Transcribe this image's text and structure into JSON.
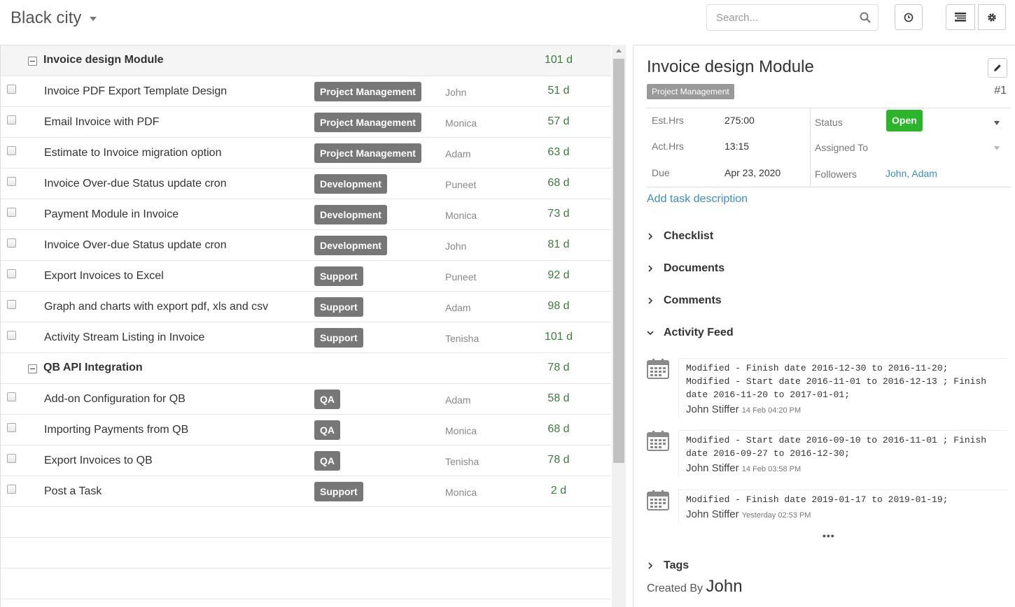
{
  "header": {
    "project": "Black city",
    "search_placeholder": "Search..."
  },
  "task_list": {
    "rows": [
      {
        "kind": "group",
        "name": "Invoice design Module",
        "days": "101 d"
      },
      {
        "kind": "task",
        "name": "Invoice PDF Export Template Design",
        "label": "Project Management",
        "assignee": "John",
        "days": "51 d"
      },
      {
        "kind": "task",
        "name": "Email Invoice with PDF",
        "label": "Project Management",
        "assignee": "Monica",
        "days": "57 d"
      },
      {
        "kind": "task",
        "name": "Estimate to Invoice migration option",
        "label": "Project Management",
        "assignee": "Adam",
        "days": "63 d"
      },
      {
        "kind": "task",
        "name": "Invoice Over-due Status update cron",
        "label": "Development",
        "assignee": "Puneet",
        "days": "68 d"
      },
      {
        "kind": "task",
        "name": "Payment Module in Invoice",
        "label": "Development",
        "assignee": "Monica",
        "days": "73 d"
      },
      {
        "kind": "task",
        "name": "Invoice Over-due Status update cron",
        "label": "Development",
        "assignee": "John",
        "days": "81 d"
      },
      {
        "kind": "task",
        "name": "Export Invoices to Excel",
        "label": "Support",
        "assignee": "Puneet",
        "days": "92 d"
      },
      {
        "kind": "task",
        "name": "Graph and charts with export pdf, xls and csv",
        "label": "Support",
        "assignee": "Adam",
        "days": "98 d"
      },
      {
        "kind": "task",
        "name": "Activity Stream Listing in Invoice",
        "label": "Support",
        "assignee": "Tenisha",
        "days": "101 d"
      },
      {
        "kind": "group",
        "name": "QB API Integration",
        "days": "78 d"
      },
      {
        "kind": "task",
        "name": "Add-on Configuration for QB",
        "label": "QA",
        "assignee": "Adam",
        "days": "58 d"
      },
      {
        "kind": "task",
        "name": "Importing Payments from QB",
        "label": "QA",
        "assignee": "Monica",
        "days": "68 d"
      },
      {
        "kind": "task",
        "name": "Export Invoices to QB",
        "label": "QA",
        "assignee": "Tenisha",
        "days": "78 d"
      },
      {
        "kind": "task",
        "name": "Post a Task",
        "label": "Support",
        "assignee": "Monica",
        "days": "2 d"
      }
    ]
  },
  "detail": {
    "title": "Invoice design Module",
    "label": "Project Management",
    "id": "#1",
    "est_hrs_label": "Est.Hrs",
    "est_hrs": "275:00",
    "act_hrs_label": "Act.Hrs",
    "act_hrs": "13:15",
    "due_label": "Due",
    "due": "Apr 23, 2020",
    "status_label": "Status",
    "status": "Open",
    "assigned_label": "Assigned To",
    "followers_label": "Followers",
    "followers": "John, Adam",
    "add_description": "Add task description",
    "sections": {
      "checklist": "Checklist",
      "documents": "Documents",
      "comments": "Comments",
      "activity_feed": "Activity Feed",
      "tags": "Tags"
    },
    "activity": [
      {
        "text": "Modified - Finish date 2016-12-30 to 2016-11-20;\nModified - Start date 2016-11-01 to 2016-12-13 ; Finish\ndate 2016-11-20 to 2017-01-01;",
        "user": "John Stiffer",
        "time": "14 Feb 04:20 PM"
      },
      {
        "text": "Modified - Start date 2016-09-10 to 2016-11-01 ; Finish\ndate 2016-09-27 to 2016-12-30;",
        "user": "John Stiffer",
        "time": "14 Feb 03:58 PM"
      },
      {
        "text": "Modified - Finish date 2019-01-17 to 2019-01-19;",
        "user": "John Stiffer",
        "time": "Yesterday 02:53 PM"
      }
    ],
    "more": "•••",
    "created_by_label": "Created By",
    "created_by": "John"
  },
  "colors": {
    "label_bg": "#777777",
    "days_green": "#3a7d3a",
    "status_green": "#2bb52b",
    "link_blue": "#3a8ec8"
  }
}
